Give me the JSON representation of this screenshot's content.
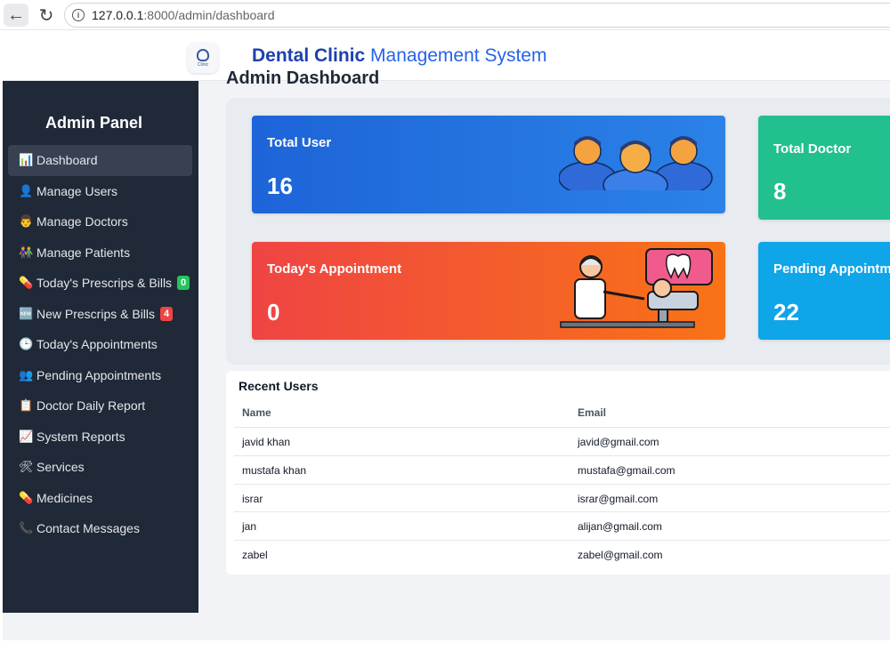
{
  "browser": {
    "url_host": "127.0.0.1",
    "url_path": ":8000/admin/dashboard"
  },
  "header": {
    "brand_strong": "Dental Clinic",
    "brand_rest": "Management System",
    "logo_text": "Clinic"
  },
  "sidebar": {
    "title": "Admin Panel",
    "items": [
      {
        "label": "Dashboard",
        "icon": "bar-chart-icon",
        "glyph": "📊"
      },
      {
        "label": "Manage Users",
        "icon": "user-icon",
        "glyph": "👤"
      },
      {
        "label": "Manage Doctors",
        "icon": "doctor-icon",
        "glyph": "👨"
      },
      {
        "label": "Manage Patients",
        "icon": "patients-icon",
        "glyph": "👫"
      },
      {
        "label": "Today's Prescrips & Bills",
        "icon": "pill-icon",
        "glyph": "💊",
        "badge": "0"
      },
      {
        "label": "New Prescrips & Bills",
        "icon": "new-icon",
        "glyph": "🆕",
        "badge": "4"
      },
      {
        "label": "Today's Appointments",
        "icon": "clock-icon",
        "glyph": "🕒"
      },
      {
        "label": "Pending Appointments",
        "icon": "user-wait-icon",
        "glyph": "👥"
      },
      {
        "label": "Doctor Daily Report",
        "icon": "clipboard-icon",
        "glyph": "📋"
      },
      {
        "label": "System Reports",
        "icon": "line-chart-icon",
        "glyph": "📈"
      },
      {
        "label": "Services",
        "icon": "tools-icon",
        "glyph": "🛠"
      },
      {
        "label": "Medicines",
        "icon": "medicine-icon",
        "glyph": "💊"
      },
      {
        "label": "Contact Messages",
        "icon": "phone-icon",
        "glyph": "📞"
      }
    ]
  },
  "main": {
    "title": "Admin Dashboard",
    "cards": {
      "total_user": {
        "label": "Total User",
        "value": "16"
      },
      "total_doctor": {
        "label": "Total Doctor",
        "value": "8"
      },
      "todays_appointment": {
        "label": "Today's Appointment",
        "value": "0"
      },
      "pending_appointment": {
        "label": "Pending Appointm",
        "value": "22"
      }
    },
    "recent_users": {
      "title": "Recent Users",
      "columns": [
        "Name",
        "Email"
      ],
      "rows": [
        [
          "javid khan",
          "javid@gmail.com"
        ],
        [
          "mustafa khan",
          "mustafa@gmail.com"
        ],
        [
          "israr",
          "israr@gmail.com"
        ],
        [
          "jan",
          "alijan@gmail.com"
        ],
        [
          "zabel",
          "zabel@gmail.com"
        ]
      ]
    }
  },
  "colors": {
    "sidebar_bg": "#1f2937",
    "card_blue": "#1d64d8",
    "card_green": "#22c08f",
    "card_red": "#ef4444",
    "card_sky": "#0ea5e9",
    "badge_green": "#22c55e",
    "badge_red": "#ef4444"
  }
}
